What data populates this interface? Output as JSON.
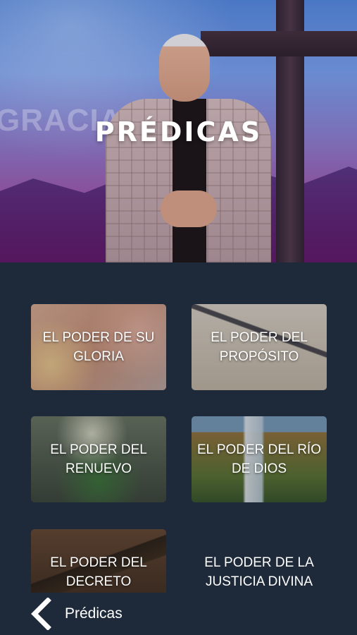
{
  "header": {
    "title": "PRÉDICAS",
    "background_word": "GRACIA"
  },
  "cards": [
    {
      "label": "EL PODER DE SU GLORIA"
    },
    {
      "label": "EL PODER DEL PROPÓSITO"
    },
    {
      "label": "EL PODER DEL RENUEVO"
    },
    {
      "label": "EL PODER DEL RÍO DE DIOS"
    },
    {
      "label": "EL PODER DEL DECRETO"
    },
    {
      "label": "EL PODER DE LA JUSTICIA DIVINA"
    }
  ],
  "bottom_bar": {
    "back_icon": "chevron-left-icon",
    "title": "Prédicas"
  },
  "colors": {
    "panel_background": "#1e2a3a",
    "text": "#ffffff"
  }
}
